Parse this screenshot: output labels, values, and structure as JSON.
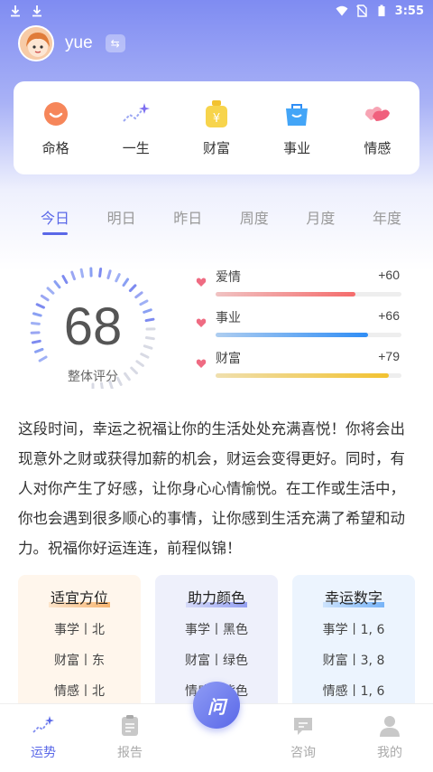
{
  "status_bar": {
    "time": "3:55"
  },
  "user": {
    "name": "yue"
  },
  "categories": [
    {
      "label": "命格",
      "icon": "face-icon"
    },
    {
      "label": "一生",
      "icon": "sparkle-line-icon"
    },
    {
      "label": "财富",
      "icon": "money-bag-icon"
    },
    {
      "label": "事业",
      "icon": "briefcase-icon"
    },
    {
      "label": "情感",
      "icon": "hearts-icon"
    }
  ],
  "tabs": [
    "今日",
    "明日",
    "昨日",
    "周度",
    "月度",
    "年度"
  ],
  "active_tab": "今日",
  "score": {
    "value": "68",
    "label": "整体评分",
    "fraction": 0.68
  },
  "bars": [
    {
      "name": "爱情",
      "value": "+60",
      "fraction": 0.75,
      "color": "#f56c6c"
    },
    {
      "name": "事业",
      "value": "+66",
      "fraction": 0.82,
      "color": "#2f8df5"
    },
    {
      "name": "财富",
      "value": "+79",
      "fraction": 0.93,
      "color": "#f2c230"
    }
  ],
  "fortune_text": "这段时间，幸运之祝福让你的生活处处充满喜悦！你将会出现意外之财或获得加薪的机会，财运会变得更好。同时，有人对你产生了好感，让你身心心情愉悦。在工作或生活中，你也会遇到很多顺心的事情，让你感到生活充满了希望和动力。祝福你好运连连，前程似锦！",
  "info_cards": [
    {
      "title": "适宜方位",
      "items": [
        "事学丨北",
        "财富丨东",
        "情感丨北"
      ],
      "bg": "#fff6ec",
      "accent": "#f5a552"
    },
    {
      "title": "助力颜色",
      "items": [
        "事学丨黑色",
        "财富丨绿色",
        "情感丨紫色"
      ],
      "bg": "#eef0fb",
      "accent": "#7e8cf0"
    },
    {
      "title": "幸运数字",
      "items": [
        "事学丨1, 6",
        "财富丨3, 8",
        "情感丨1, 6"
      ],
      "bg": "#ecf4fe",
      "accent": "#5aa3f5"
    }
  ],
  "nav": [
    {
      "label": "运势",
      "icon": "sparkle-line-icon",
      "active": true
    },
    {
      "label": "报告",
      "icon": "report-icon",
      "active": false
    },
    {
      "label": "咨询",
      "icon": "chat-icon",
      "active": false
    },
    {
      "label": "我的",
      "icon": "person-icon",
      "active": false
    }
  ],
  "center_button": {
    "label": "问"
  },
  "colors": {
    "accent": "#5a68e8",
    "hero": "#7f8cf2"
  }
}
